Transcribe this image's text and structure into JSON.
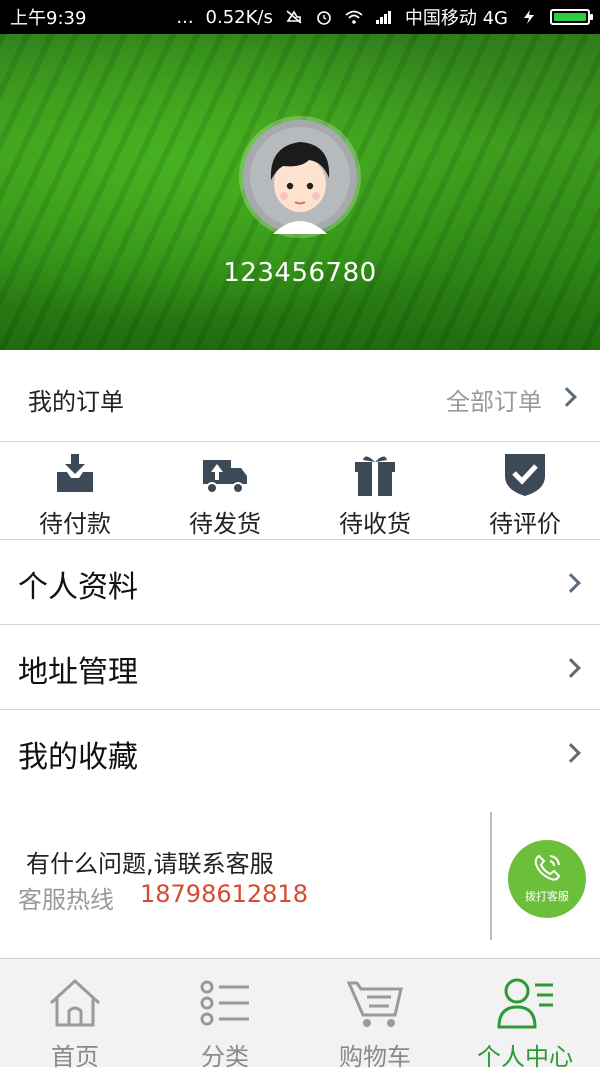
{
  "status_bar": {
    "time": "上午9:39",
    "dots": "...",
    "speed": "0.52K/s",
    "carrier": "中国移动 4G",
    "icons": [
      "mute-icon",
      "alarm-icon",
      "wifi-icon",
      "signal-icon",
      "charging-icon",
      "battery-icon"
    ]
  },
  "profile": {
    "user_id": "123456780",
    "avatar_icon": "cartoon-avatar"
  },
  "orders": {
    "title": "我的订单",
    "all_orders": "全部订单",
    "statuses": [
      {
        "label": "待付款",
        "icon": "download-tray-icon"
      },
      {
        "label": "待发货",
        "icon": "truck-icon"
      },
      {
        "label": "待收货",
        "icon": "gift-box-icon"
      },
      {
        "label": "待评价",
        "icon": "shield-check-icon"
      }
    ]
  },
  "menu": [
    {
      "label": "个人资料"
    },
    {
      "label": "地址管理"
    },
    {
      "label": "我的收藏"
    }
  ],
  "contact": {
    "question": "有什么问题,请联系客服",
    "hotline_label": "客服热线",
    "phone": "18798612818",
    "call_button": "拨打客服"
  },
  "tabs": [
    {
      "label": "首页",
      "icon": "home-icon",
      "active": false
    },
    {
      "label": "分类",
      "icon": "list-icon",
      "active": false
    },
    {
      "label": "购物车",
      "icon": "cart-icon",
      "active": false
    },
    {
      "label": "个人中心",
      "icon": "user-icon",
      "active": true
    }
  ],
  "colors": {
    "accent_green": "#2c9a36",
    "phone_red": "#d64a2f",
    "call_button_green": "#6cbf3a"
  }
}
